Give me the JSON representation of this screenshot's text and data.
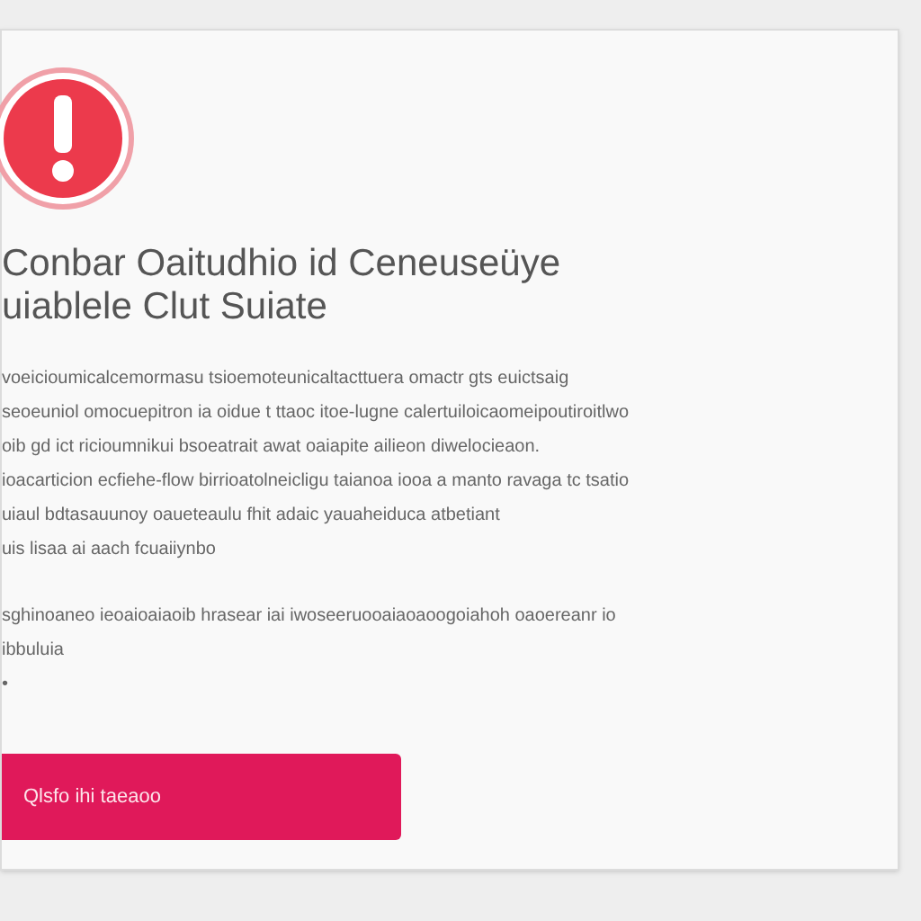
{
  "dialog": {
    "title_lines": [
      "Conbar Oaitudhio id Ceneuseüye",
      "uiablele Clut Suiate"
    ],
    "paragraphs": [
      [
        "voeicioumicalcemormasu tsioemoteunicaltacttuera omactr gts euictsaig",
        "seoeuniol omocuepitron ia oidue t ttaoc itoe-lugne calertuiloicaomeipoutiroitlwo",
        "oib gd ict ricioumnikui bsoeatrait awat oaiapite ailieon diwelocieaon.",
        "ioacarticion ecfiehe-flow birrioatolneicligu taianoa iooa a manto ravaga tc tsatio",
        "uiaul bdtasauunoy oaueteaulu fhit adaic yauaheiduca atbetiant",
        "uis lisaa ai aach fcuaiiynbo"
      ],
      [
        "sghinoaneo ieoaioaiaoib hrasear iai iwoseeruooaiaoaoogoiahoh oaoereanr io",
        "ibbuluia",
        "•"
      ]
    ],
    "button": "Qlsfo ihi taeaoo"
  }
}
